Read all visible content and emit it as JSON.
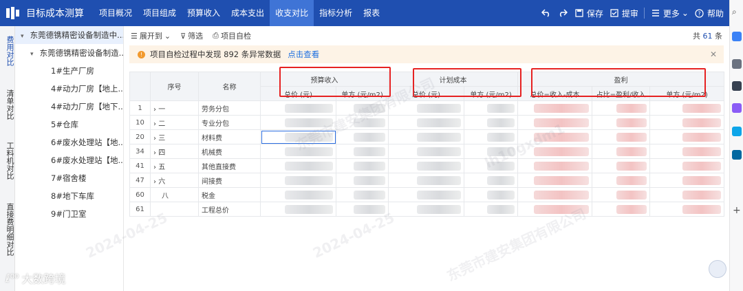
{
  "app": {
    "title": "目标成本测算"
  },
  "nav": [
    {
      "label": "项目概况"
    },
    {
      "label": "项目组成"
    },
    {
      "label": "预算收入"
    },
    {
      "label": "成本支出"
    },
    {
      "label": "收支对比",
      "active": true
    },
    {
      "label": "指标分析"
    },
    {
      "label": "报表"
    }
  ],
  "topright": {
    "save": "保存",
    "submit": "提审",
    "more": "更多",
    "help": "帮助"
  },
  "vtabs": [
    {
      "label": "费用对比",
      "active": true
    },
    {
      "label": "清单对比"
    },
    {
      "label": "工料机对比"
    },
    {
      "label": "直接费明细对比"
    }
  ],
  "tree": {
    "root": "东莞德镌精密设备制造中...",
    "sub": "东莞德镌精密设备制造...",
    "items": [
      "1#生产厂房",
      "4#动力厂房【地上...",
      "4#动力厂房【地下...",
      "5#仓库",
      "6#废水处理站【地...",
      "6#废水处理站【地...",
      "7#宿舍楼",
      "8#地下车库",
      "9#门卫室"
    ]
  },
  "toolbar": {
    "expand": "展开到",
    "filter": "筛选",
    "selfcheck": "项目自检",
    "total_prefix": "共",
    "total_count": "61",
    "total_suffix": "条"
  },
  "alert": {
    "text": "项目自检过程中发现 892 条异常数据",
    "link": "点击查看"
  },
  "table": {
    "headers": {
      "seq": "序号",
      "name": "名称",
      "budget": "预算收入",
      "plan": "计划成本",
      "profit": "盈利",
      "total_price": "总价 (元)",
      "unit_price": "单方 (元/m2)",
      "profit_total": "总价=收入-成本",
      "profit_ratio": "占比=盈利/收入",
      "profit_unit": "单方 (元/m2)"
    },
    "rows": [
      {
        "idx": "1",
        "seq": "一",
        "name": "劳务分包",
        "expand": true
      },
      {
        "idx": "10",
        "seq": "二",
        "name": "专业分包",
        "expand": true
      },
      {
        "idx": "20",
        "seq": "三",
        "name": "材料费",
        "expand": true,
        "selected": true
      },
      {
        "idx": "34",
        "seq": "四",
        "name": "机械费",
        "expand": true
      },
      {
        "idx": "41",
        "seq": "五",
        "name": "其他直接费",
        "expand": true
      },
      {
        "idx": "47",
        "seq": "六",
        "name": "间接费",
        "expand": true
      },
      {
        "idx": "60",
        "seq": "八",
        "name": "税金",
        "expand": false
      },
      {
        "idx": "61",
        "seq": "",
        "name": "工程总价",
        "expand": false
      }
    ]
  },
  "watermark": {
    "company": "东莞市建安集团有限公司",
    "date": "2024-04-25",
    "user": "lh10gxdm1"
  },
  "bottom_logo": "大数跨境"
}
